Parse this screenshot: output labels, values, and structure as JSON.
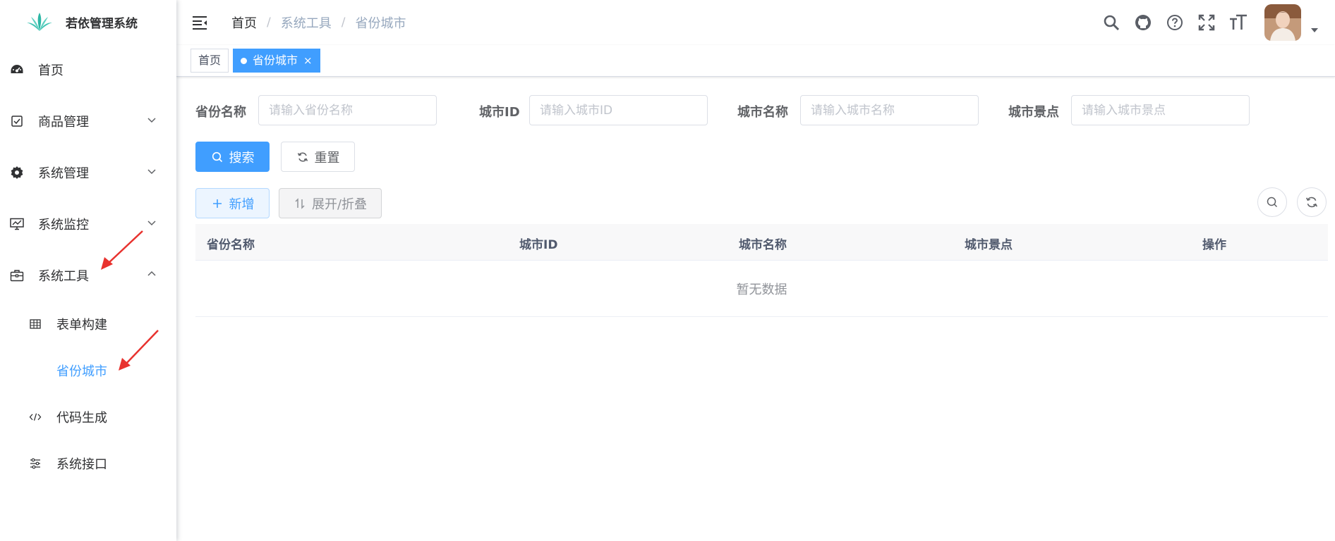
{
  "app": {
    "title": "若依管理系统"
  },
  "sidebar": {
    "items": [
      {
        "label": "首页",
        "icon": "dashboard-icon"
      },
      {
        "label": "商品管理",
        "icon": "checkbox-icon"
      },
      {
        "label": "系统管理",
        "icon": "gear-icon"
      },
      {
        "label": "系统监控",
        "icon": "monitor-icon"
      },
      {
        "label": "系统工具",
        "icon": "toolbox-icon"
      }
    ],
    "subitems": [
      {
        "label": "表单构建",
        "icon": "table-icon"
      },
      {
        "label": "省份城市",
        "icon": "",
        "active": true
      },
      {
        "label": "代码生成",
        "icon": "code-icon"
      },
      {
        "label": "系统接口",
        "icon": "sliders-icon"
      }
    ]
  },
  "navbar": {
    "breadcrumb": [
      "首页",
      "系统工具",
      "省份城市"
    ],
    "separator": "/"
  },
  "tags": [
    {
      "label": "首页",
      "active": false
    },
    {
      "label": "省份城市",
      "active": true
    }
  ],
  "search": {
    "fields": [
      {
        "label": "省份名称",
        "placeholder": "请输入省份名称"
      },
      {
        "label": "城市ID",
        "placeholder": "请输入城市ID"
      },
      {
        "label": "城市名称",
        "placeholder": "请输入城市名称"
      },
      {
        "label": "城市景点",
        "placeholder": "请输入城市景点"
      }
    ],
    "search_label": "搜索",
    "reset_label": "重置"
  },
  "toolbar": {
    "add_label": "新增",
    "expand_label": "展开/折叠"
  },
  "table": {
    "columns": [
      "省份名称",
      "城市ID",
      "城市名称",
      "城市景点",
      "操作"
    ],
    "empty_text": "暂无数据"
  },
  "colors": {
    "primary": "#409eff",
    "annotation": "#e8322e"
  }
}
